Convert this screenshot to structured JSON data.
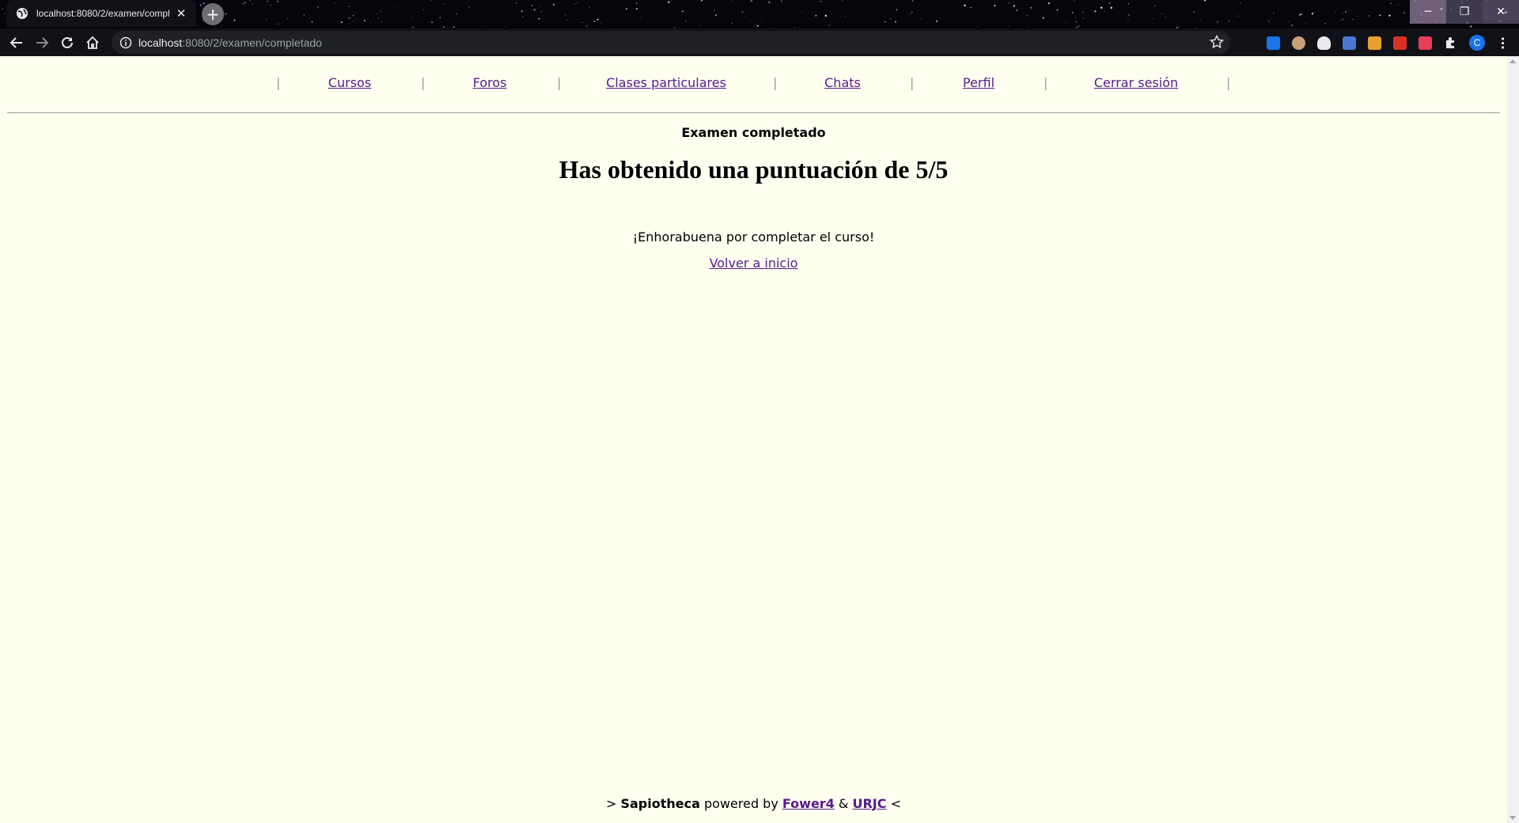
{
  "browser": {
    "tab_title": "localhost:8080/2/examen/compl",
    "new_tab_label": "+",
    "url_host": "localhost",
    "url_path": ":8080/2/examen/completado",
    "profile_initial": "C"
  },
  "nav": {
    "separator": "|",
    "links": [
      "Cursos",
      "Foros",
      "Clases particulares",
      "Chats",
      "Perfil",
      "Cerrar sesión"
    ]
  },
  "main": {
    "subtitle": "Examen completado",
    "score_text": "Has obtenido una puntuación de 5/5",
    "congrats_text": "¡Enhorabuena por completar el curso!",
    "back_link": "Volver a inicio"
  },
  "footer": {
    "prefix": "> ",
    "brand": "Sapiotheca",
    "powered_by": " powered by ",
    "link1": "Fower4",
    "amp": " & ",
    "link2": "URJC",
    "suffix": " <"
  },
  "colors": {
    "page_bg": "#fffff0",
    "link": "#551a8b",
    "chrome_bg": "#111217"
  }
}
